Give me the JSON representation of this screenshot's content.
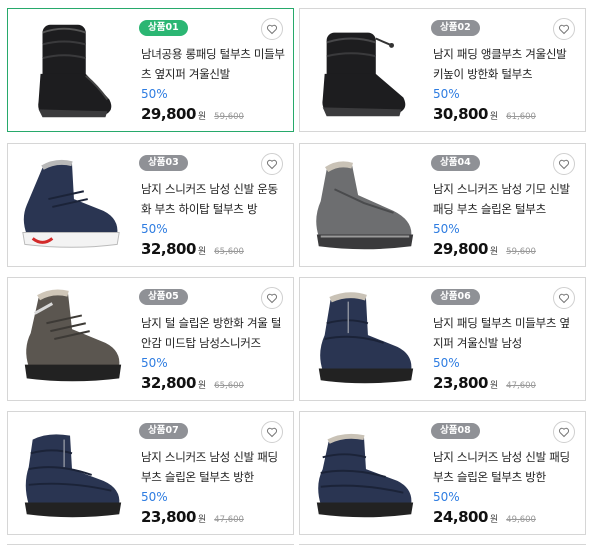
{
  "colors": {
    "badge_selected": "#2bb673",
    "badge_default": "#8f9196",
    "discount": "#2f7de1",
    "selected_border": "#27a96b",
    "boot_black": "#1d1d1f",
    "boot_navy": "#2a3552",
    "boot_gray": "#6d6e70"
  },
  "products": [
    {
      "badge": "상품01",
      "title": "남녀공용 롱패딩 털부츠 미들부츠 옆지퍼 겨울신발",
      "discount": "50%",
      "price": "29,800",
      "won": "원",
      "original_price": "59,600",
      "image": "black-puffer-mid-boot",
      "selected": true
    },
    {
      "badge": "상품02",
      "title": "남지 패딩 앵클부츠 겨울신발 키높이 방한화 털부츠",
      "discount": "50%",
      "price": "30,800",
      "won": "원",
      "original_price": "61,600",
      "image": "black-puffer-ankle-boot",
      "selected": false
    },
    {
      "badge": "상품03",
      "title": "남지 스니커즈 남성 신발 운동화 부츠 하이탑 털부츠 방",
      "discount": "50%",
      "price": "32,800",
      "won": "원",
      "original_price": "65,600",
      "image": "navy-hightop-sneaker",
      "selected": false
    },
    {
      "badge": "상품04",
      "title": "남지 스니커즈 남성 기모 신발 패딩 부츠 슬립온 털부츠",
      "discount": "50%",
      "price": "29,800",
      "won": "원",
      "original_price": "59,600",
      "image": "gray-fur-sneaker-boot",
      "selected": false
    },
    {
      "badge": "상품05",
      "title": "남지 털 슬립온 방한화 겨울 털안감 미드탑 남성스니커즈",
      "discount": "50%",
      "price": "32,800",
      "won": "원",
      "original_price": "65,600",
      "image": "gray-hiking-boot",
      "selected": false
    },
    {
      "badge": "상품06",
      "title": "남지 패딩 털부츠 미들부츠 옆지퍼 겨울신발 남성",
      "discount": "50%",
      "price": "23,800",
      "won": "원",
      "original_price": "47,600",
      "image": "navy-padded-boot",
      "selected": false
    },
    {
      "badge": "상품07",
      "title": "남지 스니커즈 남성 신발 패딩 부츠 슬립온 털부츠 방한",
      "discount": "50%",
      "price": "23,800",
      "won": "원",
      "original_price": "47,600",
      "image": "navy-zip-ankle-boot",
      "selected": false
    },
    {
      "badge": "상품08",
      "title": "남지 스니커즈 남성 신발 패딩 부츠 슬립온 털부츠 방한",
      "discount": "50%",
      "price": "24,800",
      "won": "원",
      "original_price": "49,600",
      "image": "navy-slip-on-boot",
      "selected": false
    }
  ]
}
